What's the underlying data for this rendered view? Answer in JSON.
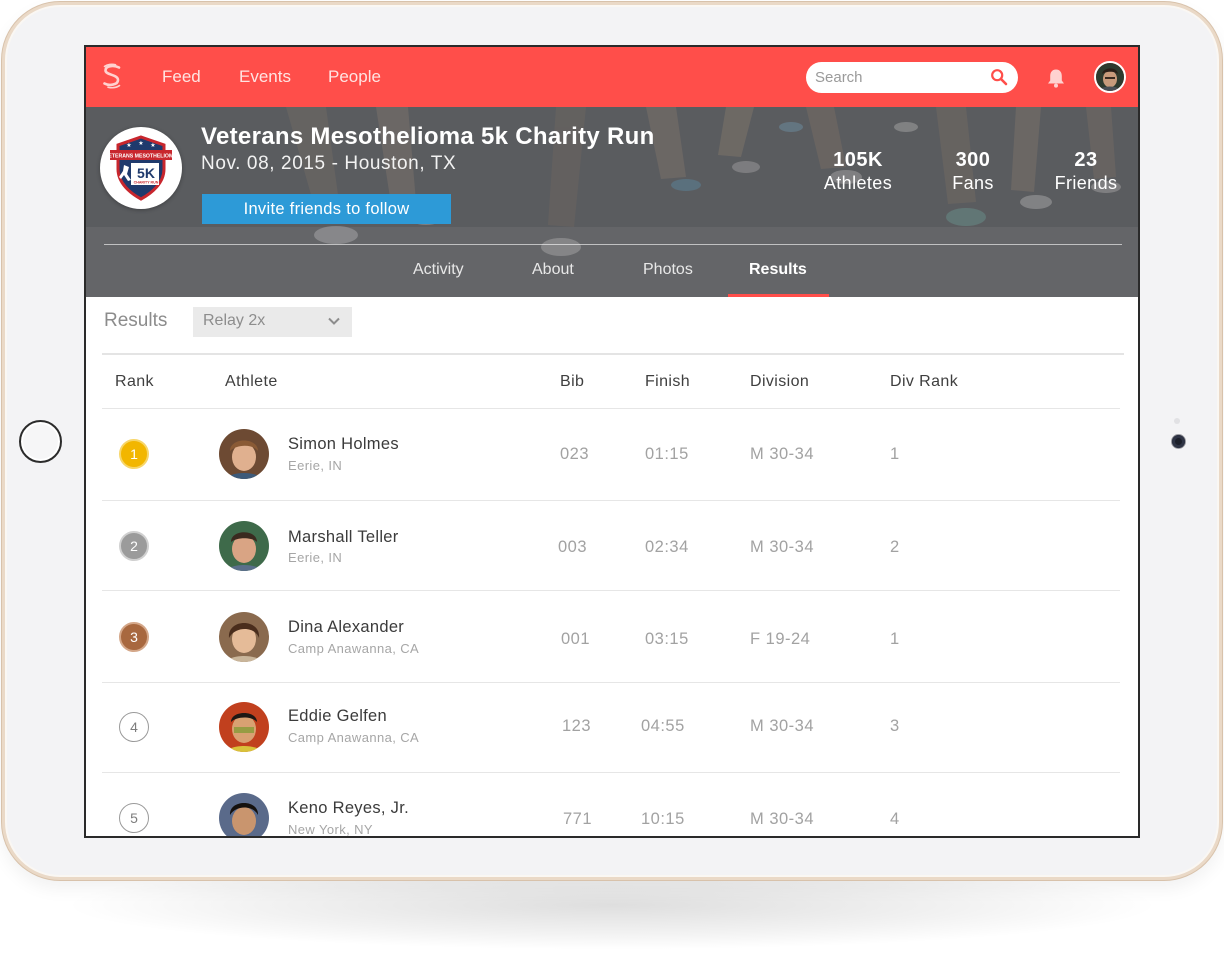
{
  "nav": {
    "links": [
      "Feed",
      "Events",
      "People"
    ],
    "search_placeholder": "Search",
    "brand_color": "#ff4e4a"
  },
  "event": {
    "logo_text_top": "VETERANS MESOTHELIOMA",
    "logo_text_main": "5K",
    "logo_text_sub": "CHARITY RUN",
    "title": "Veterans Mesothelioma 5k Charity Run",
    "date_location": "Nov. 08, 2015 - Houston, TX",
    "invite_label": "Invite friends to follow",
    "stats": [
      {
        "value": "105K",
        "label": "Athletes"
      },
      {
        "value": "300",
        "label": "Fans"
      },
      {
        "value": "23",
        "label": "Friends"
      }
    ],
    "tabs": [
      "Activity",
      "About",
      "Photos",
      "Results"
    ],
    "active_tab": "Results"
  },
  "results": {
    "label": "Results",
    "filter_value": "Relay 2x",
    "columns": [
      "Rank",
      "Athlete",
      "Bib",
      "Finish",
      "Division",
      "Div Rank"
    ],
    "rows": [
      {
        "rank": "1",
        "name": "Simon Holmes",
        "location": "Eerie, IN",
        "bib": "023",
        "finish": "01:15",
        "division": "M 30-34",
        "div_rank": "1"
      },
      {
        "rank": "2",
        "name": "Marshall Teller",
        "location": "Eerie, IN",
        "bib": "003",
        "finish": "02:34",
        "division": "M 30-34",
        "div_rank": "2"
      },
      {
        "rank": "3",
        "name": "Dina Alexander",
        "location": "Camp Anawanna, CA",
        "bib": "001",
        "finish": "03:15",
        "division": "F 19-24",
        "div_rank": "1"
      },
      {
        "rank": "4",
        "name": "Eddie Gelfen",
        "location": "Camp Anawanna, CA",
        "bib": "123",
        "finish": "04:55",
        "division": "M 30-34",
        "div_rank": "3"
      },
      {
        "rank": "5",
        "name": "Keno Reyes, Jr.",
        "location": "New York, NY",
        "bib": "771",
        "finish": "10:15",
        "division": "M 30-34",
        "div_rank": "4"
      }
    ],
    "medal_colors": {
      "gold": "#f2b600",
      "silver": "#9b9b9b",
      "bronze": "#a8683f"
    }
  }
}
